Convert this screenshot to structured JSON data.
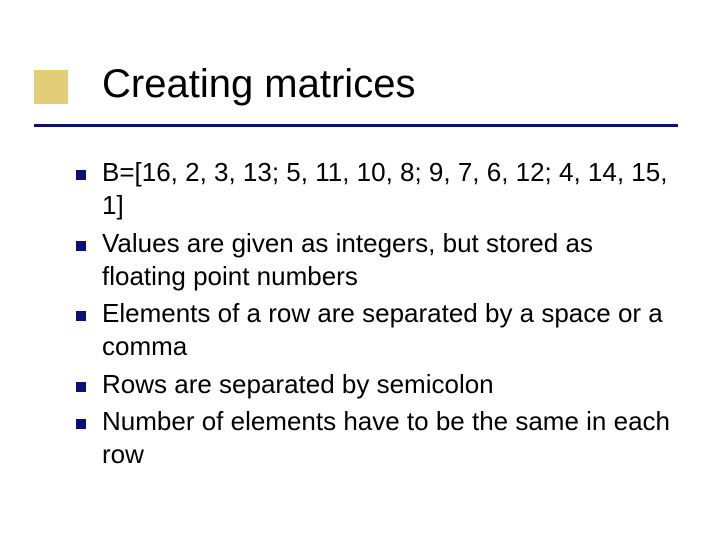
{
  "title": "Creating matrices",
  "bullets": [
    "B=[16, 2, 3, 13; 5, 11, 10, 8; 9, 7, 6, 12; 4, 14, 15, 1]",
    "Values are given as integers, but stored as floating point numbers",
    "Elements of a row are separated by a space or a comma",
    "Rows are separated by semicolon",
    "Number of elements have to be the same in each row"
  ]
}
